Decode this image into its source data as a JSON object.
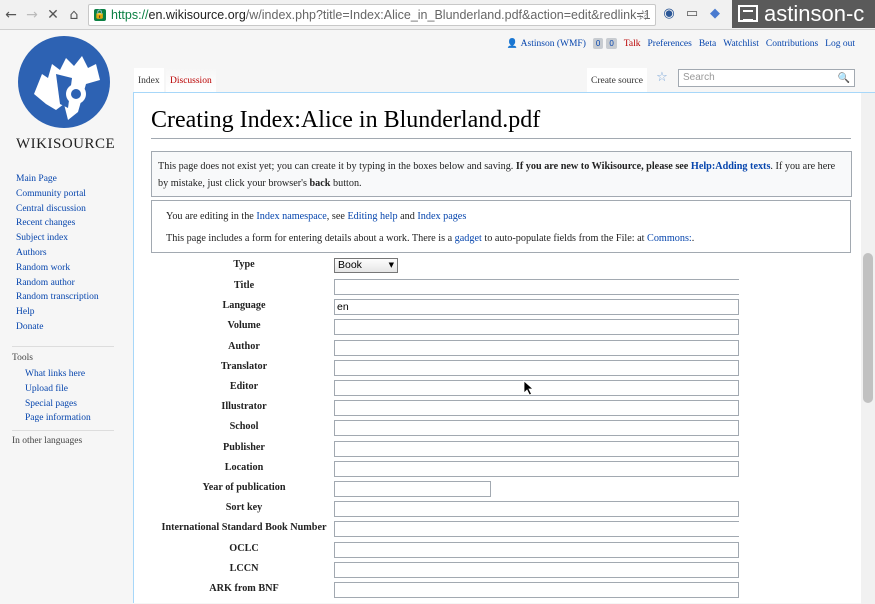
{
  "browser": {
    "url_scheme": "https://",
    "url_host": "en.wikisource.org",
    "url_rest": "/w/index.php?title=Index:Alice_in_Blunderland.pdf&action=edit&redlink=1",
    "overlay_text": "astinson-c"
  },
  "sidebar": {
    "wordmark": "WIKISOURCE",
    "nav": [
      "Main Page",
      "Community portal",
      "Central discussion",
      "Recent changes",
      "Subject index",
      "Authors",
      "Random work",
      "Random author",
      "Random transcription",
      "Help",
      "Donate"
    ],
    "tools_heading": "Tools",
    "tools": [
      "What links here",
      "Upload file",
      "Special pages",
      "Page information"
    ],
    "languages_heading": "In other languages"
  },
  "personal": {
    "user": "Astinson (WMF)",
    "badge1": "0",
    "badge2": "0",
    "talk": "Talk",
    "preferences": "Preferences",
    "beta": "Beta",
    "watchlist": "Watchlist",
    "contributions": "Contributions",
    "logout": "Log out"
  },
  "tabs": {
    "index": "Index",
    "discussion": "Discussion",
    "create": "Create source"
  },
  "search": {
    "placeholder": "Search"
  },
  "page": {
    "title": "Creating Index:Alice in Blunderland.pdf",
    "notice_1": "This page does not exist yet; you can create it by typing in the boxes below and saving. ",
    "notice_bold": "If you are new to Wikisource, please see ",
    "notice_link": "Help:Adding texts",
    "notice_2": ". If you are here by mistake, just click your browser's ",
    "notice_back": "back",
    "notice_3": " button.",
    "edit_1": "You are editing in the ",
    "edit_link1": "Index namespace",
    "edit_2": ", see ",
    "edit_link2": "Editing help",
    "edit_3": " and ",
    "edit_link3": "Index pages",
    "edit_4": "This page includes a form for entering details about a work. There is a ",
    "edit_link4": "gadget",
    "edit_5": " to auto-populate fields from the File: at ",
    "edit_link5": "Commons:",
    "edit_6": "."
  },
  "form": {
    "type_label": "Type",
    "type_value": "Book",
    "fields": [
      {
        "label": "Title",
        "value": ""
      },
      {
        "label": "Language",
        "value": "en"
      },
      {
        "label": "Volume",
        "value": ""
      },
      {
        "label": "Author",
        "value": ""
      },
      {
        "label": "Translator",
        "value": ""
      },
      {
        "label": "Editor",
        "value": ""
      },
      {
        "label": "Illustrator",
        "value": ""
      },
      {
        "label": "School",
        "value": ""
      },
      {
        "label": "Publisher",
        "value": ""
      },
      {
        "label": "Location",
        "value": ""
      },
      {
        "label": "Year of publication",
        "value": ""
      },
      {
        "label": "Sort key",
        "value": ""
      },
      {
        "label": "International Standard Book Number",
        "value": ""
      },
      {
        "label": "OCLC",
        "value": ""
      },
      {
        "label": "LCCN",
        "value": ""
      },
      {
        "label": "ARK from BNF",
        "value": ""
      }
    ]
  }
}
